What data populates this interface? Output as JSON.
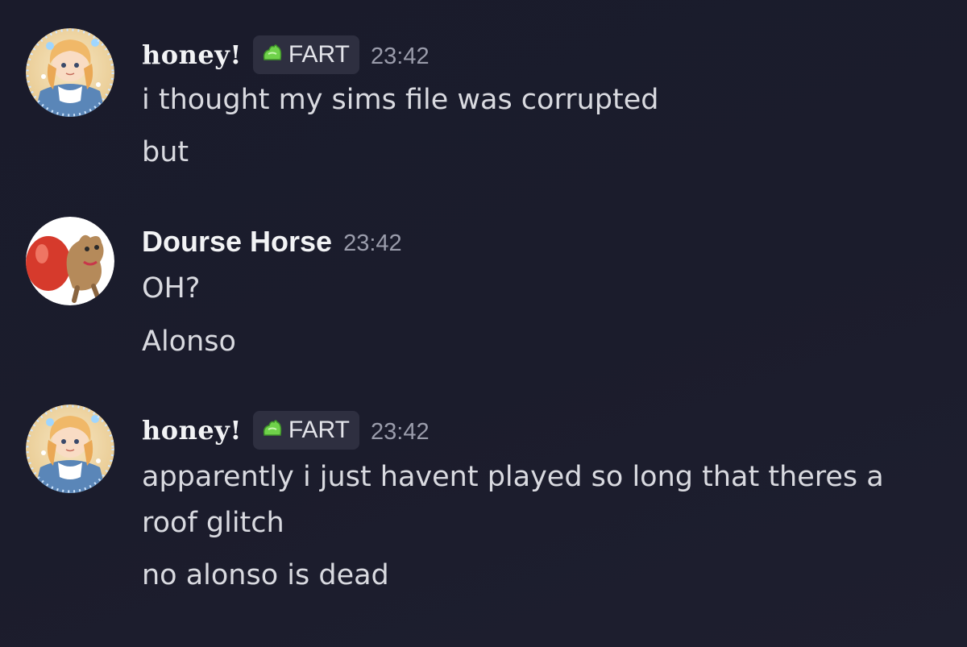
{
  "messages": [
    {
      "author": "honey!",
      "tag": "FART",
      "time": "23:42",
      "lines": [
        "i thought my sims file was corrupted",
        "but"
      ]
    },
    {
      "author": "Dourse Horse",
      "time": "23:42",
      "lines": [
        "OH?",
        "Alonso"
      ]
    },
    {
      "author": "honey!",
      "tag": "FART",
      "time": "23:42",
      "lines": [
        "apparently i just havent played so long that theres a",
        "roof glitch",
        "no alonso is dead"
      ]
    }
  ],
  "colors": {
    "background": "#1b1c2c",
    "username": "#f2f3f5",
    "message_text": "#d9dae0",
    "timestamp": "#9a9cab",
    "tag_background": "#2e2f40",
    "tag_icon": "#6fd24a"
  },
  "icons": {
    "tag_icon": "green-slime-icon"
  }
}
